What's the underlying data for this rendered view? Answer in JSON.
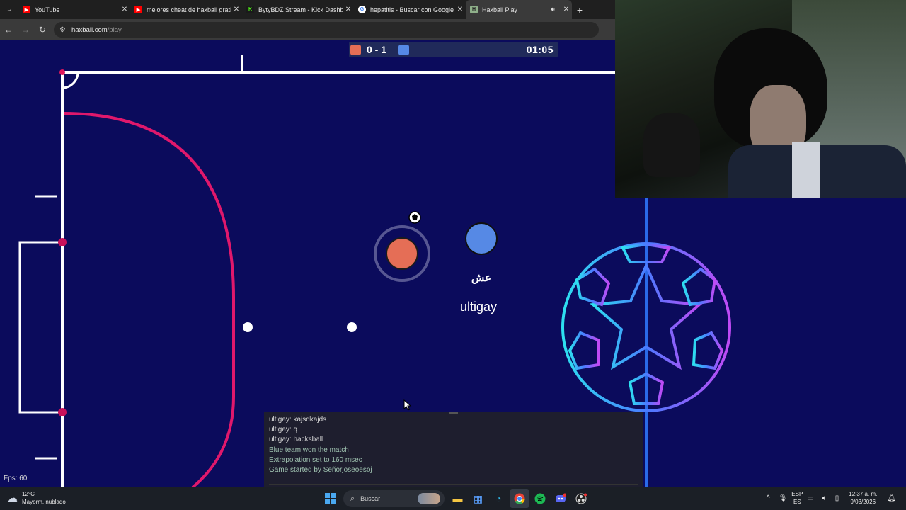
{
  "browser": {
    "tabs": [
      {
        "title": "YouTube",
        "favicon_color": "#ff0000"
      },
      {
        "title": "mejores cheat de haxball gratis",
        "favicon_color": "#ff0000"
      },
      {
        "title": "BytyBDZ Stream - Kick Dashboard",
        "favicon_color": "#53fc18"
      },
      {
        "title": "hepatitis - Buscar con Google",
        "favicon_color": "#ffffff"
      },
      {
        "title": "Haxball Play",
        "favicon_color": "#8fb08a"
      }
    ],
    "address": {
      "domain": "haxball.com",
      "path": "/play"
    }
  },
  "game": {
    "score": "0 - 1",
    "clock": "01:05",
    "red_color": "#e56e56",
    "blue_color": "#5689e5",
    "player_name": "ultigay",
    "player_avatar": "عش"
  },
  "chat": {
    "lines": [
      {
        "text": "ultigay: kajsdkajds",
        "system": false
      },
      {
        "text": "ultigay: q",
        "system": false
      },
      {
        "text": "ultigay: hacksball",
        "system": false
      },
      {
        "text": "Blue team won the match",
        "system": true
      },
      {
        "text": "Extrapolation set to 160 msec",
        "system": true
      },
      {
        "text": "Game started by Señorjoseoesoj",
        "system": true
      }
    ]
  },
  "fps": "Fps: 60",
  "taskbar": {
    "weather_temp": "12°C",
    "weather_desc": "Mayorm. nublado",
    "search_placeholder": "Buscar",
    "lang_top": "ESP",
    "lang_bottom": "ES",
    "time": "12:37 a. m.",
    "date": "9/03/2026"
  }
}
